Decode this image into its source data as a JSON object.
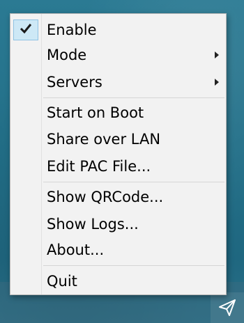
{
  "menu": {
    "items": [
      {
        "label": "Enable",
        "checked": true,
        "submenu": false
      },
      {
        "label": "Mode",
        "checked": false,
        "submenu": true
      },
      {
        "label": "Servers",
        "checked": false,
        "submenu": true
      },
      {
        "label": "Start on Boot",
        "checked": false,
        "submenu": false
      },
      {
        "label": "Share over LAN",
        "checked": false,
        "submenu": false
      },
      {
        "label": "Edit PAC File...",
        "checked": false,
        "submenu": false
      },
      {
        "label": "Show QRCode...",
        "checked": false,
        "submenu": false
      },
      {
        "label": "Show Logs...",
        "checked": false,
        "submenu": false
      },
      {
        "label": "About...",
        "checked": false,
        "submenu": false
      },
      {
        "label": "Quit",
        "checked": false,
        "submenu": false
      }
    ]
  },
  "tray": {
    "icon": "paper-plane-icon"
  },
  "colors": {
    "menu_background": "#f2f2f2",
    "check_highlight": "#cde8f6",
    "desktop": "#226f88"
  }
}
